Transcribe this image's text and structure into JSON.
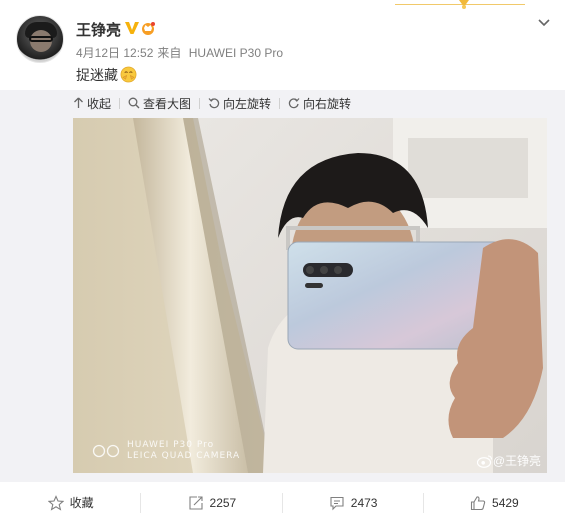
{
  "post": {
    "author": "王铮亮",
    "date": "4月12日 12:52",
    "source_prefix": "来自",
    "source": "HUAWEI P30 Pro",
    "text": "捉迷藏"
  },
  "toolbar": {
    "collapse": "收起",
    "view_large": "查看大图",
    "rotate_left": "向左旋转",
    "rotate_right": "向右旋转"
  },
  "photo": {
    "watermark_line1": "HUAWEI P30 Pro",
    "watermark_line2": "LEICA QUAD CAMERA",
    "weibo_watermark": "@王铮亮"
  },
  "actions": {
    "favorite": "收藏",
    "repost_count": "2257",
    "comment_count": "2473",
    "like_count": "5429"
  },
  "colors": {
    "accent_orange": "#f79e24",
    "verified_gold": "#f6b20d",
    "ribbon_gold": "#f1c96a",
    "muted_text": "#808080",
    "media_bg": "#f2f2f5"
  },
  "icons": [
    "verified-badge-icon",
    "vip-crown-icon",
    "chevron-down-icon",
    "collapse-arrow-icon",
    "magnify-icon",
    "rotate-left-icon",
    "rotate-right-icon",
    "star-icon",
    "repost-icon",
    "comment-icon",
    "thumb-up-icon",
    "weibo-logo-icon"
  ]
}
